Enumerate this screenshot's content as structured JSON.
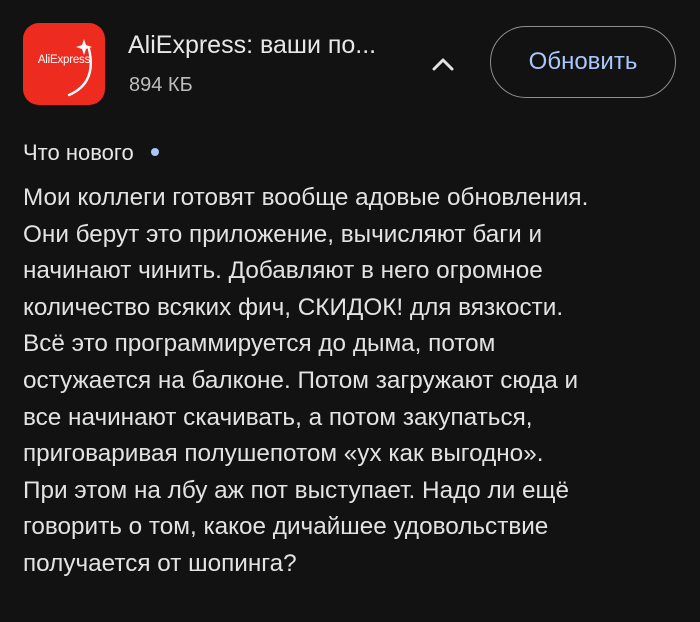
{
  "app": {
    "icon_label": "AliExpress",
    "name": "AliExpress: ваши по...",
    "size": "894 КБ",
    "brand_color": "#ee2b1f"
  },
  "actions": {
    "collapse_icon": "chevron-up-icon",
    "update_label": "Обновить",
    "accent_color": "#a8c7fa"
  },
  "whats_new": {
    "title": "Что нового",
    "lines": [
      "Мои коллеги готовят вообще адовые обновления.",
      "Они берут это приложение, вычисляют баги и",
      "начинают чинить. Добавляют в него огромное",
      "количество всяких фич, СКИДОК! для вязкости.",
      "Всё это программируется до дыма, потом",
      "остужается на балконе. Потом загружают сюда и",
      "все начинают скачивать, а потом закупаться,",
      "приговаривая полушепотом «ух как выгодно».",
      "При этом на лбу аж пот выступает. Надо ли ещё",
      "говорить о том, какое дичайшее удовольствие",
      "получается от шопинга?"
    ]
  }
}
